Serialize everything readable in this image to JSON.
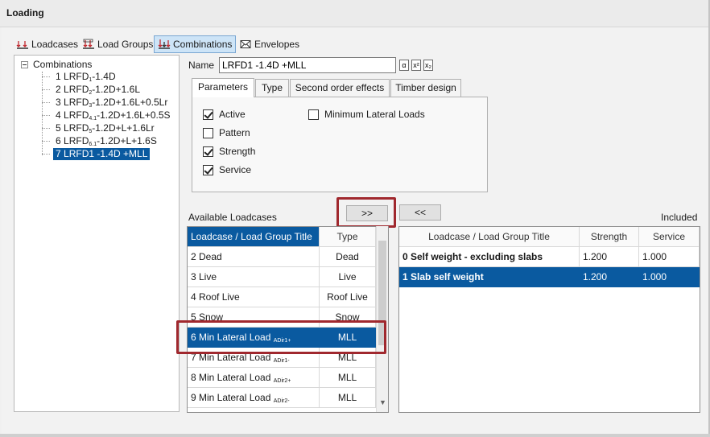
{
  "window": {
    "title": "Loading"
  },
  "top_tabs": [
    {
      "label": "Loadcases",
      "icon": "loadcases-icon"
    },
    {
      "label": "Load Groups",
      "icon": "load-groups-icon"
    },
    {
      "label": "Combinations",
      "icon": "combinations-icon",
      "active": true
    },
    {
      "label": "Envelopes",
      "icon": "envelopes-icon"
    }
  ],
  "tree": {
    "root": "Combinations",
    "items": [
      {
        "num": "1",
        "pre": "LRFD",
        "sub": "1",
        "post": "-1.4D"
      },
      {
        "num": "2",
        "pre": "LRFD",
        "sub": "2",
        "post": "-1.2D+1.6L"
      },
      {
        "num": "3",
        "pre": "LRFD",
        "sub": "3",
        "post": "-1.2D+1.6L+0.5Lr"
      },
      {
        "num": "4",
        "pre": "LRFD",
        "sub": "4.1",
        "post": "-1.2D+1.6L+0.5S"
      },
      {
        "num": "5",
        "pre": "LRFD",
        "sub": "5",
        "post": "-1.2D+L+1.6Lr"
      },
      {
        "num": "6",
        "pre": "LRFD",
        "sub": "6.1",
        "post": "-1.2D+L+1.6S"
      },
      {
        "num": "7",
        "pre": "LRFD1 -1.4D +MLL",
        "sub": "",
        "post": "",
        "selected": true
      }
    ]
  },
  "name_field": {
    "label": "Name",
    "value": "LRFD1 -1.4D +MLL",
    "format_buttons": [
      "α",
      "x²",
      "x₂"
    ]
  },
  "param_tabs": [
    "Parameters",
    "Type",
    "Second order effects",
    "Timber design"
  ],
  "parameters": {
    "active": {
      "label": "Active",
      "checked": true
    },
    "pattern": {
      "label": "Pattern",
      "checked": false
    },
    "strength": {
      "label": "Strength",
      "checked": true
    },
    "service": {
      "label": "Service",
      "checked": true
    },
    "min_lateral": {
      "label": "Minimum Lateral Loads",
      "checked": false
    }
  },
  "buttons": {
    "add": ">>",
    "remove": "<<"
  },
  "available": {
    "label": "Available Loadcases",
    "headers": [
      "Loadcase / Load Group Title",
      "Type"
    ],
    "rows": [
      {
        "title": "2 Dead",
        "sub": "",
        "type": "Dead"
      },
      {
        "title": "3 Live",
        "sub": "",
        "type": "Live"
      },
      {
        "title": "4 Roof Live",
        "sub": "",
        "type": "Roof Live"
      },
      {
        "title": "5 Snow",
        "sub": "",
        "type": "Snow"
      },
      {
        "title": "6 Min Lateral Load",
        "sub": "ADir1+",
        "type": "MLL",
        "selected": true
      },
      {
        "title": "7 Min Lateral Load",
        "sub": "ADir1-",
        "type": "MLL"
      },
      {
        "title": "8 Min Lateral Load",
        "sub": "ADir2+",
        "type": "MLL"
      },
      {
        "title": "9 Min Lateral Load",
        "sub": "ADir2-",
        "type": "MLL"
      }
    ]
  },
  "included": {
    "label": "Included",
    "headers": [
      "Loadcase / Load Group Title",
      "Strength",
      "Service"
    ],
    "rows": [
      {
        "title": "0 Self weight - excluding slabs",
        "strength": "1.200",
        "service": "1.000"
      },
      {
        "title": "1 Slab self weight",
        "strength": "1.200",
        "service": "1.000",
        "selected": true
      }
    ]
  },
  "colors": {
    "selection": "#0a5aa0",
    "highlight": "#a0282e",
    "active_tab": "#cde4f7"
  }
}
